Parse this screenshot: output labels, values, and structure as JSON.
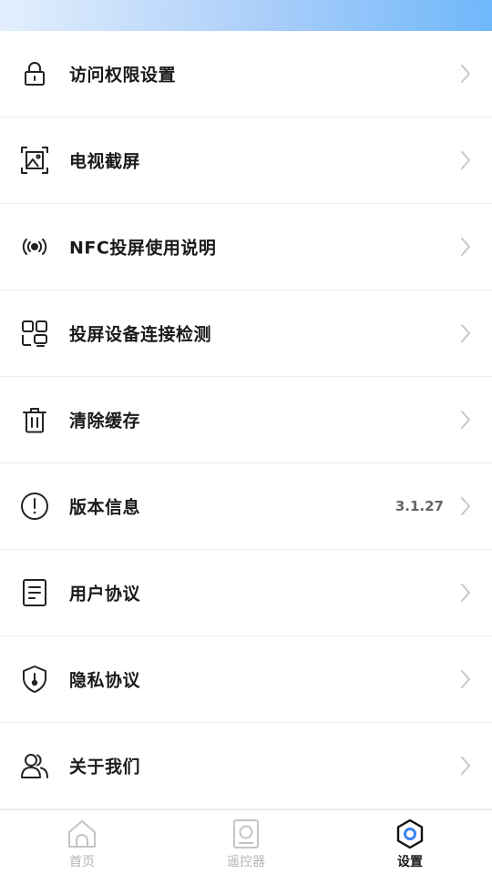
{
  "menu": {
    "items": [
      {
        "label": "访问权限设置",
        "icon": "lock-icon"
      },
      {
        "label": "电视截屏",
        "icon": "screenshot-icon"
      },
      {
        "label": "NFC投屏使用说明",
        "icon": "nfc-icon"
      },
      {
        "label": "投屏设备连接检测",
        "icon": "device-detect-icon"
      },
      {
        "label": "清除缓存",
        "icon": "trash-icon"
      },
      {
        "label": "版本信息",
        "icon": "info-icon",
        "value": "3.1.27"
      },
      {
        "label": "用户协议",
        "icon": "document-icon"
      },
      {
        "label": "隐私协议",
        "icon": "shield-icon"
      },
      {
        "label": "关于我们",
        "icon": "users-icon"
      }
    ]
  },
  "tabbar": {
    "tabs": [
      {
        "label": "首页",
        "icon": "home-icon",
        "active": false
      },
      {
        "label": "遥控器",
        "icon": "remote-icon",
        "active": false
      },
      {
        "label": "设置",
        "icon": "settings-hexagon-icon",
        "active": true
      }
    ]
  },
  "colors": {
    "accent": "#3b82f6",
    "text": "#1a1a1a",
    "muted": "#b5b5b5",
    "divider": "#ececec",
    "status_gradient_end": "#6fb8fb"
  }
}
